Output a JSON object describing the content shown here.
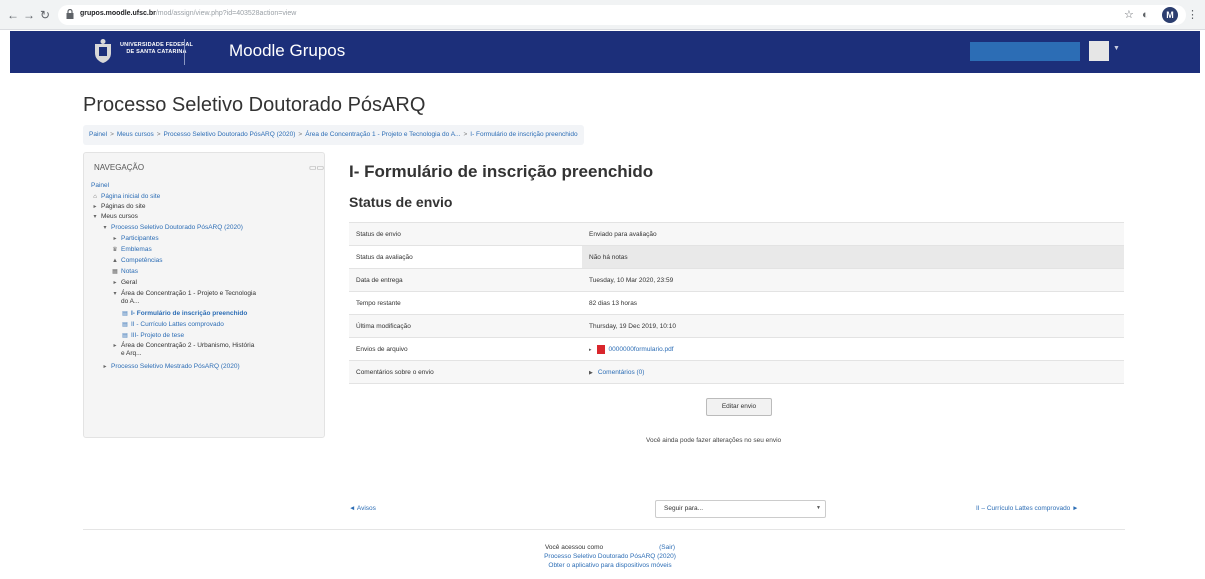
{
  "browser": {
    "url_host": "grupos.moodle.ufsc.br",
    "url_path": "/mod/assign/view.php?id=403528action=view",
    "back_icon": "back-arrow-icon",
    "forward_icon": "forward-arrow-icon",
    "reload_icon": "reload-icon",
    "profile_initial": "M"
  },
  "navbar": {
    "university_line1": "UNIVERSIDADE FEDERAL",
    "university_line2": "DE SANTA CATARINA",
    "site_name": "Moodle Grupos",
    "color": "#1c2f7a"
  },
  "page": {
    "course_title": "Processo Seletivo Doutorado PósARQ",
    "breadcrumb": [
      "Painel",
      "Meus cursos",
      "Processo Seletivo Doutorado PósARQ (2020)",
      "Área de Concentração 1 - Projeto e Tecnologia do A...",
      "I- Formulário de inscrição preenchido"
    ]
  },
  "navigation": {
    "title": "NAVEGAÇÃO",
    "items": [
      {
        "label": "Painel"
      },
      {
        "label": "Página inicial do site"
      },
      {
        "label": "Páginas do site"
      },
      {
        "label": "Meus cursos"
      },
      {
        "label": "Processo Seletivo Doutorado PósARQ (2020)"
      },
      {
        "label": "Participantes"
      },
      {
        "label": "Emblemas"
      },
      {
        "label": "Competências"
      },
      {
        "label": "Notas"
      },
      {
        "label": "Geral"
      },
      {
        "label": "Área de Concentração 1 - Projeto e Tecnologia",
        "label2": "do A..."
      },
      {
        "label": "I- Formulário de inscrição preenchido"
      },
      {
        "label": "II - Currículo Lattes comprovado"
      },
      {
        "label": "III- Projeto de tese"
      },
      {
        "label": "Área de Concentração 2 - Urbanismo, História",
        "label2": "e Arq..."
      },
      {
        "label": "Processo Seletivo Mestrado PósARQ (2020)"
      }
    ]
  },
  "main": {
    "activity_title": "I- Formulário de inscrição preenchido",
    "status_heading": "Status de envio",
    "rows": [
      {
        "label": "Status de envio",
        "value": "Enviado para avaliação"
      },
      {
        "label": "Status da avaliação",
        "value": "Não há notas"
      },
      {
        "label": "Data de entrega",
        "value": "Tuesday, 10 Mar 2020, 23:59"
      },
      {
        "label": "Tempo restante",
        "value": "82 dias 13 horas"
      },
      {
        "label": "Última modificação",
        "value": "Thursday, 19 Dec 2019, 10:10"
      },
      {
        "label": "Envios de arquivo",
        "value": "0000000formulario.pdf"
      },
      {
        "label": "Comentários sobre o envio",
        "value": "Comentários (0)"
      }
    ],
    "edit_button": "Editar envio",
    "edit_note": "Você ainda pode fazer alterações no seu envio"
  },
  "activity_nav": {
    "prev": "◄ Avisos",
    "jump_placeholder": "Seguir para...",
    "next": "II – Currículo Lattes comprovado ►"
  },
  "footer": {
    "logged_in_as": "Você acessou como",
    "logout": "(Sair)",
    "course_link": "Processo Seletivo Doutorado PósARQ (2020)",
    "mobile_app": "Obter o aplicativo para dispositivos móveis"
  }
}
